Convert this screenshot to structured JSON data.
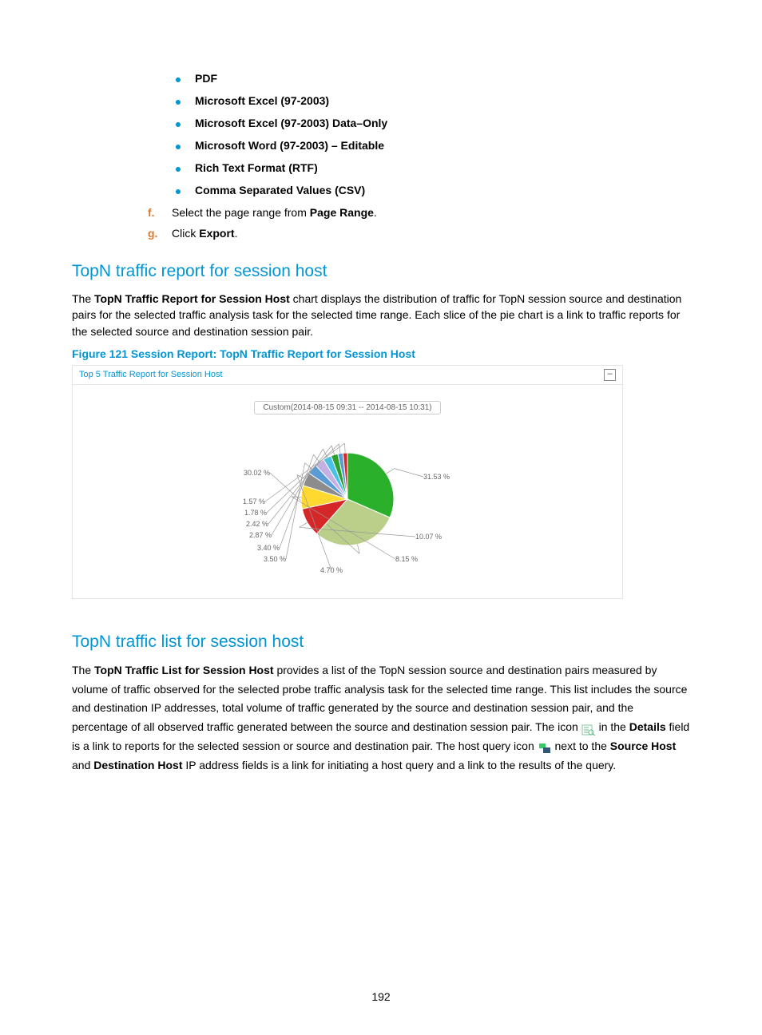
{
  "formats": [
    "PDF",
    "Microsoft Excel (97-2003)",
    "Microsoft Excel (97-2003) Data–Only",
    "Microsoft Word (97-2003) – Editable",
    "Rich Text Format (RTF)",
    "Comma Separated Values (CSV)"
  ],
  "steps": {
    "f": {
      "letter": "f.",
      "pre": "Select the page range from ",
      "bold": "Page Range",
      "post": "."
    },
    "g": {
      "letter": "g.",
      "pre": "Click ",
      "bold": "Export",
      "post": "."
    }
  },
  "section1": {
    "heading": "TopN traffic report for session host",
    "para_pre": "The ",
    "para_bold": "TopN Traffic Report for Session Host",
    "para_post": " chart displays the distribution of traffic for TopN session source and destination pairs for the selected traffic analysis task for the selected time range. Each slice of the pie chart is a link to traffic reports for the selected source and destination session pair.",
    "fig_caption": "Figure 121 Session Report: TopN Traffic Report for Session Host",
    "fig_title": "Top 5 Traffic Report for Session Host",
    "collapse": "–",
    "subtitle": "Custom(2014-08-15 09:31 -- 2014-08-15 10:31)"
  },
  "chart_data": {
    "type": "pie",
    "title": "Top 5 Traffic Report for Session Host",
    "subtitle": "Custom(2014-08-15 09:31 -- 2014-08-15 10:31)",
    "slices": [
      {
        "label": "31.53 %",
        "value": 31.53,
        "color": "#2bb02b"
      },
      {
        "label": "30.02 %",
        "value": 30.02,
        "color": "#b9cf8a"
      },
      {
        "label": "10.07 %",
        "value": 10.07,
        "color": "#d62728"
      },
      {
        "label": "8.15 %",
        "value": 8.15,
        "color": "#ffd92f"
      },
      {
        "label": "4.70 %",
        "value": 4.7,
        "color": "#8c8c8c"
      },
      {
        "label": "3.50 %",
        "value": 3.5,
        "color": "#5b9bd5"
      },
      {
        "label": "3.40 %",
        "value": 3.4,
        "color": "#c5b0e3"
      },
      {
        "label": "2.87 %",
        "value": 2.87,
        "color": "#4dc0e6"
      },
      {
        "label": "2.42 %",
        "value": 2.42,
        "color": "#2ca02c"
      },
      {
        "label": "1.78 %",
        "value": 1.78,
        "color": "#5b9bd5"
      },
      {
        "label": "1.57 %",
        "value": 1.57,
        "color": "#d62728"
      }
    ]
  },
  "section2": {
    "heading": "TopN traffic list for session host",
    "p1_pre": "The ",
    "p1_b1": "TopN Traffic List for Session Host",
    "p1_mid": " provides a list of the TopN session source and destination pairs measured by volume of traffic observed for the selected probe traffic analysis task for the selected time range. This list includes the source and destination IP addresses, total volume of traffic generated by the source and destination session pair, and the percentage of all observed traffic generated between the source and destination session pair. The icon ",
    "p1_in": " in the ",
    "p1_b2": "Details",
    "p1_after_details": " field is a link to reports for the selected session or source and destination pair. The host query icon ",
    "p1_next": " next to the ",
    "p1_b3": "Source Host",
    "p1_and": " and ",
    "p1_b4": "Destination Host",
    "p1_end": " IP address fields is a link for initiating a host query and a link to the results of the query."
  },
  "page_number": "192"
}
